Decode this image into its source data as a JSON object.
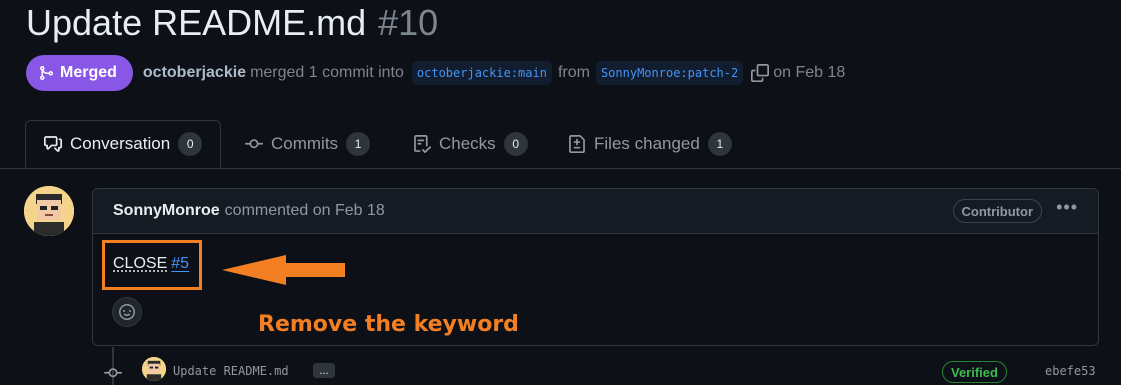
{
  "pr": {
    "title": "Update README.md",
    "number": "#10",
    "state": "Merged",
    "author": "octoberjackie",
    "merged_text": "merged 1 commit into",
    "base_branch": "octoberjackie:main",
    "from_text": "from",
    "head_branch": "SonnyMonroe:patch-2",
    "date_text": "on Feb 18"
  },
  "tabs": [
    {
      "label": "Conversation",
      "count": "0",
      "icon": "comment-discussion-icon",
      "active": true
    },
    {
      "label": "Commits",
      "count": "1",
      "icon": "git-commit-icon"
    },
    {
      "label": "Checks",
      "count": "0",
      "icon": "checklist-icon"
    },
    {
      "label": "Files changed",
      "count": "1",
      "icon": "file-diff-icon"
    }
  ],
  "comment": {
    "author": "SonnyMonroe",
    "meta": "commented on Feb 18",
    "badge": "Contributor",
    "menu": "•••",
    "body_keyword": "CLOSE",
    "body_link": "#5"
  },
  "annotation": {
    "text": "Remove the keyword",
    "color": "#f47f23"
  },
  "commit": {
    "message": "Update README.md",
    "more": "...",
    "verified": "Verified",
    "sha": "ebefe53"
  },
  "colors": {
    "background": "#0d1117",
    "merged": "#8957e5",
    "link": "#4493f8",
    "verified": "#3fb950"
  }
}
